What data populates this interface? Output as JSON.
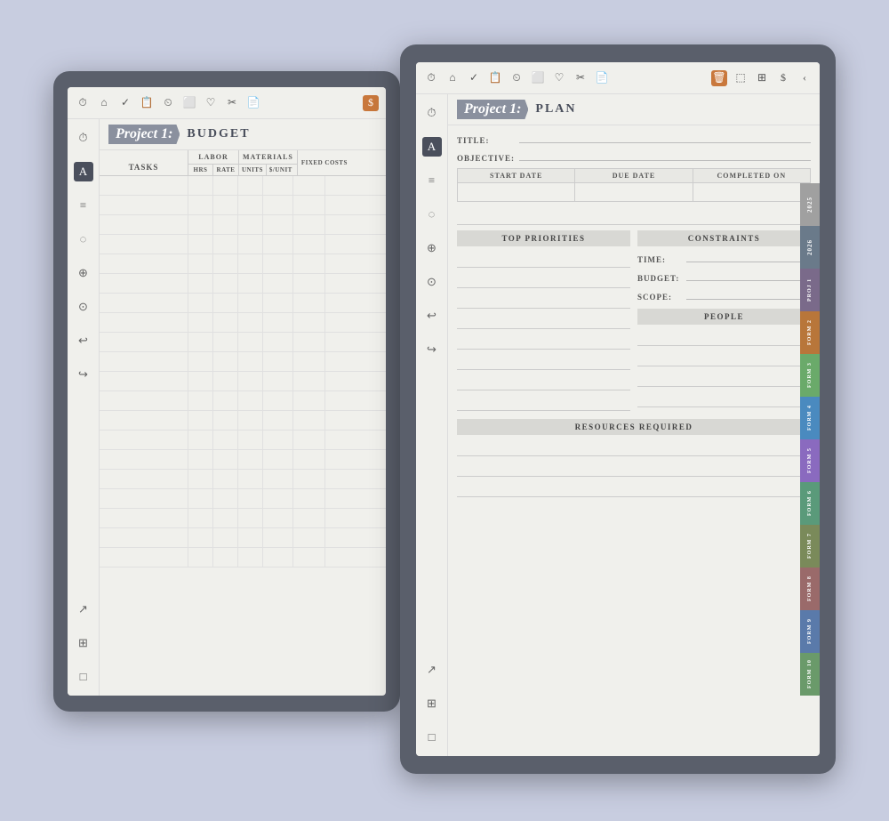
{
  "back_device": {
    "title": "Project 1:",
    "page_type": "BUDGET",
    "toolbar_icons": [
      "⏱",
      "⌂",
      "✓",
      "📋",
      "⏲",
      "⬜",
      "♡",
      "✂",
      "📄"
    ],
    "sidebar_icons": [
      "⏱",
      "A",
      "≡",
      "◌",
      "⊕",
      "⊙",
      "↩",
      "↪"
    ],
    "table": {
      "col_tasks": "TASKS",
      "col_labor": "LABOR",
      "col_materials": "MATERIALS",
      "col_fixed": "FIXED COSTS",
      "sub_labor": [
        "HRS",
        "RATE"
      ],
      "sub_materials": [
        "UNITS",
        "$/UNIT"
      ],
      "rows": 20
    }
  },
  "front_device": {
    "title": "Project 1:",
    "page_type": "PLAN",
    "toolbar_icons": [
      "⏱",
      "⌂",
      "✓",
      "📋",
      "⏲",
      "⬜",
      "♡",
      "✂",
      "📄"
    ],
    "toolbar_active": "🗑",
    "sidebar_icons": [
      "⏱",
      "A",
      "≡",
      "◌",
      "⊕",
      "⊙",
      "↩",
      "↪"
    ],
    "fields": {
      "title_label": "TITLE:",
      "objective_label": "OBJECTIVE:"
    },
    "dates": {
      "start_date": "START DATE",
      "due_date": "DUE DATE",
      "completed_on": "COMPLETED ON"
    },
    "sections": {
      "top_priorities": "TOP PRIORITIES",
      "constraints": "CONSTRAINTS",
      "people": "PEOPLE",
      "resources": "RESOURCES REQUIRED"
    },
    "constraints": {
      "time_label": "TIME:",
      "budget_label": "BUDGET:",
      "scope_label": "SCOPE:"
    },
    "tabs": [
      {
        "label": "2025",
        "color": "#a0a0a0"
      },
      {
        "label": "2026",
        "color": "#6a7a8a"
      },
      {
        "label": "PROJ 1",
        "color": "#7a6a8a"
      },
      {
        "label": "FORM 2",
        "color": "#b8763a"
      },
      {
        "label": "FORM 3",
        "color": "#6aaa6a"
      },
      {
        "label": "FORM 4",
        "color": "#4a8abf"
      },
      {
        "label": "FORM 5",
        "color": "#8a6abf"
      },
      {
        "label": "FORM 6",
        "color": "#5a9a7a"
      },
      {
        "label": "FORM 7",
        "color": "#7a8a5a"
      },
      {
        "label": "FORM 8",
        "color": "#9a6a6a"
      },
      {
        "label": "FORM 9",
        "color": "#5a7aaa"
      },
      {
        "label": "FORM 10",
        "color": "#6a9a6a"
      }
    ]
  }
}
